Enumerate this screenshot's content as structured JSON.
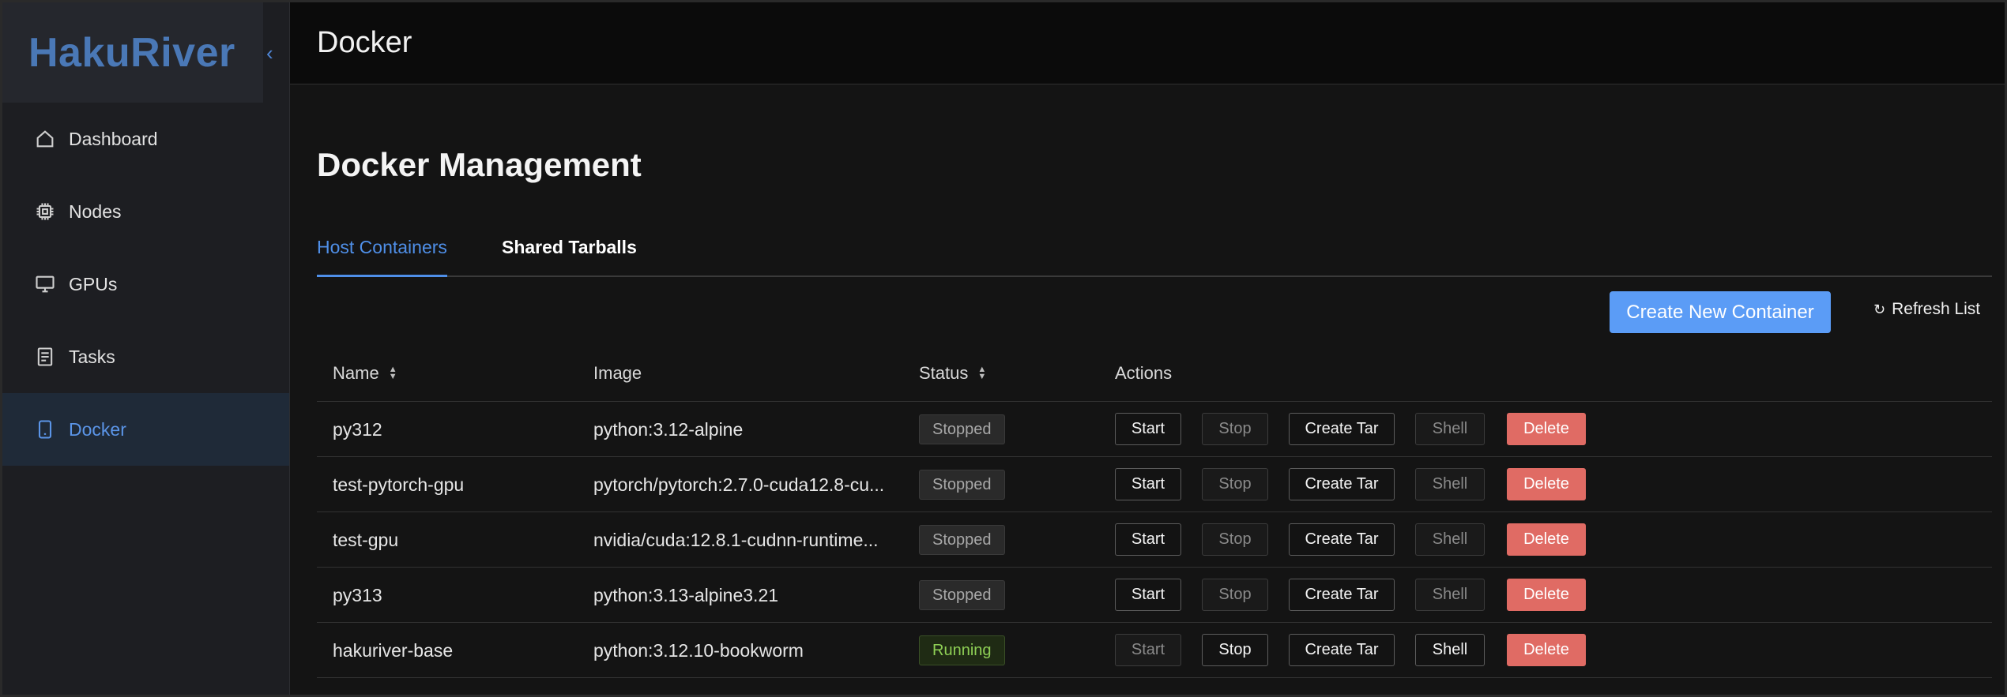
{
  "app": {
    "logo": "HakuRiver"
  },
  "sidebar": {
    "items": [
      {
        "label": "Dashboard",
        "icon": "home-icon",
        "active": false
      },
      {
        "label": "Nodes",
        "icon": "cpu-icon",
        "active": false
      },
      {
        "label": "GPUs",
        "icon": "monitor-icon",
        "active": false
      },
      {
        "label": "Tasks",
        "icon": "document-icon",
        "active": false
      },
      {
        "label": "Docker",
        "icon": "tablet-icon",
        "active": true
      }
    ]
  },
  "header": {
    "title": "Docker"
  },
  "main": {
    "title": "Docker Management",
    "tabs": [
      {
        "label": "Host Containers",
        "active": true
      },
      {
        "label": "Shared Tarballs",
        "active": false
      }
    ],
    "create_button": "Create New Container",
    "refresh_button": "Refresh List",
    "table": {
      "headers": {
        "name": "Name",
        "image": "Image",
        "status": "Status",
        "actions": "Actions"
      },
      "rows": [
        {
          "name": "py312",
          "image": "python:3.12-alpine",
          "status": "Stopped"
        },
        {
          "name": "test-pytorch-gpu",
          "image": "pytorch/pytorch:2.7.0-cuda12.8-cu...",
          "status": "Stopped"
        },
        {
          "name": "test-gpu",
          "image": "nvidia/cuda:12.8.1-cudnn-runtime...",
          "status": "Stopped"
        },
        {
          "name": "py313",
          "image": "python:3.13-alpine3.21",
          "status": "Stopped"
        },
        {
          "name": "hakuriver-base",
          "image": "python:3.12.10-bookworm",
          "status": "Running"
        }
      ],
      "actions": {
        "start": "Start",
        "stop": "Stop",
        "create_tar": "Create Tar",
        "shell": "Shell",
        "delete": "Delete"
      }
    }
  },
  "colors": {
    "accent": "#5b9cf6",
    "danger": "#e06b64",
    "running": "#8ecf55",
    "logo": "#4a78b6"
  }
}
